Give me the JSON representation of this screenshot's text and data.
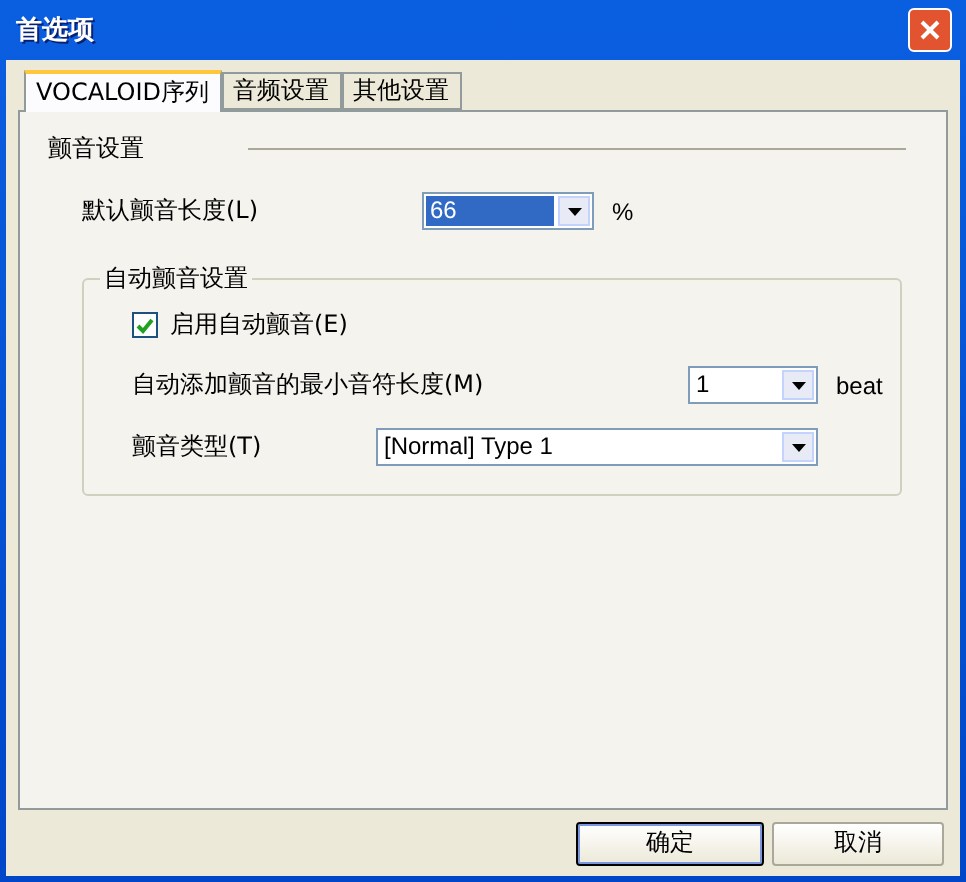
{
  "window": {
    "title": "首选项"
  },
  "tabs": [
    {
      "label": "VOCALOID序列",
      "selected": true
    },
    {
      "label": "音频设置",
      "selected": false
    },
    {
      "label": "其他设置",
      "selected": false
    }
  ],
  "section_title": "颤音设置",
  "default_length": {
    "label": "默认颤音长度(L)",
    "value": "66",
    "unit": "%",
    "focused": true
  },
  "group": {
    "title": "自动颤音设置",
    "enable": {
      "label": "启用自动颤音(E)",
      "checked": true
    },
    "min_length": {
      "label": "自动添加颤音的最小音符长度(M)",
      "value": "1",
      "unit": "beat"
    },
    "type": {
      "label": "颤音类型(T)",
      "value": "[Normal] Type 1"
    }
  },
  "buttons": [
    {
      "label": "确定",
      "default": true
    },
    {
      "label": "取消",
      "default": false
    }
  ]
}
